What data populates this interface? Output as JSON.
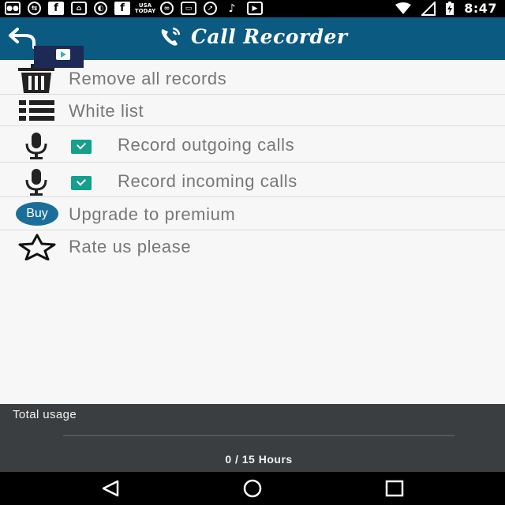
{
  "status_bar": {
    "time": "8:47",
    "icons": [
      "gamepad-icon",
      "usb-icon",
      "facebook-icon",
      "hat-icon",
      "moon-icon",
      "facebook-icon",
      "usa-today-icon",
      "link-icon",
      "cassette-icon",
      "compass-icon",
      "guitar-icon",
      "media-icon",
      "wifi-icon",
      "signal-icon",
      "battery-charging-icon"
    ],
    "usa_today_text": "USA\nTODAY"
  },
  "app_bar": {
    "title": "Call Recorder",
    "color": "#0b5a82"
  },
  "menu": {
    "items": [
      {
        "label": "Remove all records",
        "icon": "trash-icon"
      },
      {
        "label": "White list",
        "icon": "list-icon"
      },
      {
        "label": "Record outgoing calls",
        "icon": "microphone-icon",
        "checked": true
      },
      {
        "label": "Record incoming calls",
        "icon": "microphone-icon",
        "checked": true
      },
      {
        "label": "Upgrade to premium",
        "icon": "buy-badge",
        "badge": "Buy"
      },
      {
        "label": "Rate us please",
        "icon": "star-icon"
      }
    ]
  },
  "usage": {
    "title": "Total usage",
    "value_text": "0 / 15 Hours",
    "used": 0,
    "limit": 15
  },
  "nav_bar": {
    "buttons": [
      "back-triangle-icon",
      "home-circle-icon",
      "recents-square-icon"
    ]
  },
  "colors": {
    "accent": "#14a08c",
    "footer": "#3b3e40",
    "text_gray": "#777777"
  }
}
